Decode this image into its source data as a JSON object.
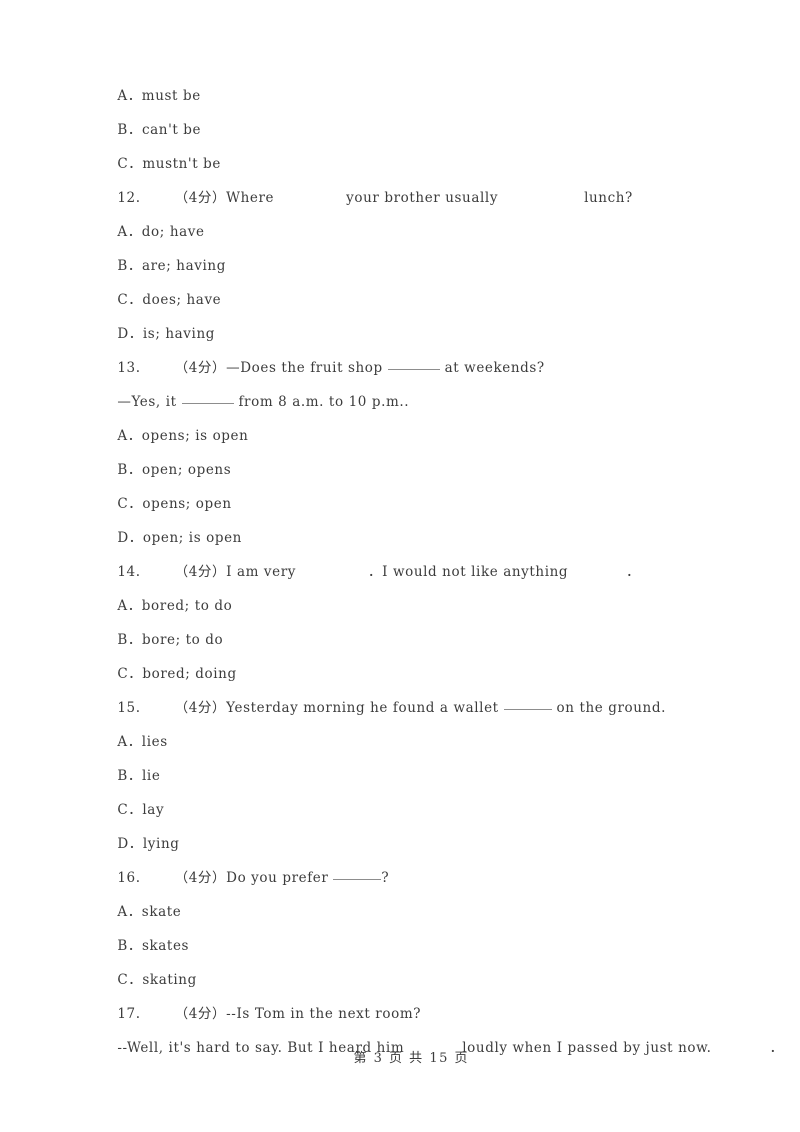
{
  "document": {
    "type": "exam-paper",
    "language": "en-with-zh-annotations",
    "page_background": "#ffffff",
    "text_color": "#3c3c3c",
    "blank_rule_color": "#8d8d8d"
  },
  "footer": {
    "text": "第 3 页 共 15 页",
    "page_number": "3",
    "total_pages": "15"
  },
  "blocks": [
    {
      "id": "opt-11-A",
      "kind": "option",
      "text": "A．must be"
    },
    {
      "id": "opt-11-B",
      "kind": "option",
      "text": "B．can't be"
    },
    {
      "id": "opt-11-C",
      "kind": "option",
      "text": "C．mustn't be"
    },
    {
      "id": "q-12",
      "kind": "question",
      "number": "12.",
      "marks": "（4分）",
      "seg1": "Where",
      "seg2": "your brother usually",
      "seg3": "lunch?"
    },
    {
      "id": "opt-12-A",
      "kind": "option",
      "text": "A．do; have"
    },
    {
      "id": "opt-12-B",
      "kind": "option",
      "text": "B．are; having"
    },
    {
      "id": "opt-12-C",
      "kind": "option",
      "text": "C．does; have"
    },
    {
      "id": "opt-12-D",
      "kind": "option",
      "text": "D．is; having"
    },
    {
      "id": "q-13",
      "kind": "question",
      "number": "13.",
      "marks": "（4分）",
      "seg1": "—Does the fruit shop",
      "seg2": "at weekends?",
      "line2_seg1": "—Yes, it",
      "line2_seg2": "from 8 a.m. to 10 p.m.."
    },
    {
      "id": "opt-13-A",
      "kind": "option",
      "text": "A．opens; is open"
    },
    {
      "id": "opt-13-B",
      "kind": "option",
      "text": "B．open; opens"
    },
    {
      "id": "opt-13-C",
      "kind": "option",
      "text": "C．opens; open"
    },
    {
      "id": "opt-13-D",
      "kind": "option",
      "text": "D．open; is open"
    },
    {
      "id": "q-14",
      "kind": "question",
      "number": "14.",
      "marks": "（4分）",
      "seg1": "I am very",
      "seg2": "．I would not like anything",
      "seg3": "．"
    },
    {
      "id": "opt-14-A",
      "kind": "option",
      "text": "A．bored; to do"
    },
    {
      "id": "opt-14-B",
      "kind": "option",
      "text": "B．bore; to do"
    },
    {
      "id": "opt-14-C",
      "kind": "option",
      "text": "C．bored; doing"
    },
    {
      "id": "q-15",
      "kind": "question",
      "number": "15.",
      "marks": "（4分）",
      "seg1": "Yesterday morning he found a wallet",
      "seg2": "on the ground."
    },
    {
      "id": "opt-15-A",
      "kind": "option",
      "text": "A．lies"
    },
    {
      "id": "opt-15-B",
      "kind": "option",
      "text": "B．lie"
    },
    {
      "id": "opt-15-C",
      "kind": "option",
      "text": "C．lay"
    },
    {
      "id": "opt-15-D",
      "kind": "option",
      "text": "D．lying"
    },
    {
      "id": "q-16",
      "kind": "question",
      "number": "16.",
      "marks": "（4分）",
      "seg1": "Do you prefer",
      "seg2": "?"
    },
    {
      "id": "opt-16-A",
      "kind": "option",
      "text": "A．skate"
    },
    {
      "id": "opt-16-B",
      "kind": "option",
      "text": "B．skates"
    },
    {
      "id": "opt-16-C",
      "kind": "option",
      "text": "C．skating"
    },
    {
      "id": "q-17",
      "kind": "question",
      "number": "17.",
      "marks": "（4分）",
      "seg1": "--Is Tom in the next room?",
      "line2_seg1": "--Well, it's hard to say. But I heard him",
      "line2_seg2": "loudly when I passed by just now.",
      "line2_seg3": "．"
    }
  ]
}
